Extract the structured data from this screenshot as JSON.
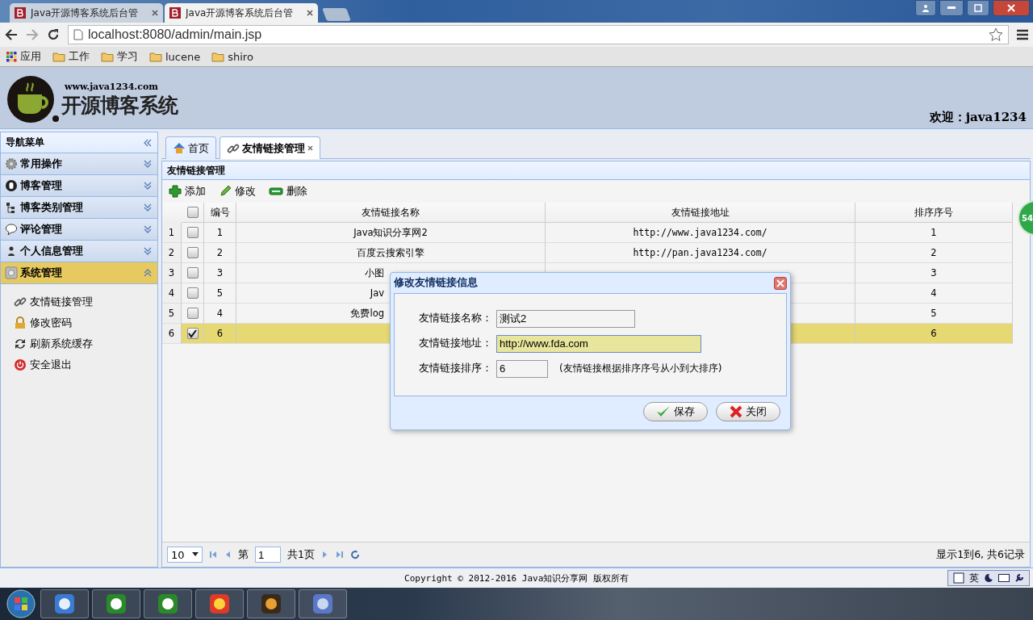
{
  "browser": {
    "tabs": [
      {
        "title": "Java开源博客系统后台管",
        "selected": false
      },
      {
        "title": "Java开源博客系统后台管",
        "selected": true
      }
    ],
    "address": "localhost:8080/admin/main.jsp",
    "bookmarks": [
      {
        "label": "应用",
        "kind": "apps"
      },
      {
        "label": "工作",
        "kind": "folder"
      },
      {
        "label": "学习",
        "kind": "folder"
      },
      {
        "label": "lucene",
        "kind": "folder"
      },
      {
        "label": "shiro",
        "kind": "folder"
      }
    ]
  },
  "header": {
    "site_url": "www.java1234.com",
    "logo_text": "开源博客系统",
    "welcome": "欢迎：java1234"
  },
  "sidebar": {
    "title": "导航菜单",
    "sections": [
      {
        "label": "常用操作",
        "expanded": false
      },
      {
        "label": "博客管理",
        "expanded": false
      },
      {
        "label": "博客类别管理",
        "expanded": false
      },
      {
        "label": "评论管理",
        "expanded": false
      },
      {
        "label": "个人信息管理",
        "expanded": false
      },
      {
        "label": "系统管理",
        "expanded": true,
        "children": [
          {
            "label": "友情链接管理"
          },
          {
            "label": "修改密码"
          },
          {
            "label": "刷新系统缓存"
          },
          {
            "label": "安全退出"
          }
        ]
      }
    ]
  },
  "content_tabs": [
    {
      "label": "首页",
      "selected": false,
      "closable": false
    },
    {
      "label": "友情链接管理",
      "selected": true,
      "closable": true
    }
  ],
  "panel": {
    "title": "友情链接管理",
    "toolbar": [
      {
        "label": "添加",
        "kind": "add"
      },
      {
        "label": "修改",
        "kind": "edit"
      },
      {
        "label": "删除",
        "kind": "delete"
      }
    ],
    "table": {
      "select_all_checked": false,
      "columns": [
        "编号",
        "友情链接名称",
        "友情链接地址",
        "排序序号"
      ],
      "rows": [
        {
          "num": "1",
          "checked": false,
          "selected": false,
          "id": "1",
          "name": "Java知识分享网2",
          "url": "http://www.java1234.com/",
          "order": "1"
        },
        {
          "num": "2",
          "checked": false,
          "selected": false,
          "id": "2",
          "name": "百度云搜索引擎",
          "url": "http://pan.java1234.com/",
          "order": "2"
        },
        {
          "num": "3",
          "checked": false,
          "selected": false,
          "id": "3",
          "name": "小图",
          "order": "3"
        },
        {
          "num": "4",
          "checked": false,
          "selected": false,
          "id": "5",
          "name": "Jav",
          "order": "4"
        },
        {
          "num": "5",
          "checked": false,
          "selected": false,
          "id": "4",
          "name": "免费log",
          "order": "5"
        },
        {
          "num": "6",
          "checked": true,
          "selected": true,
          "id": "6",
          "order": "6"
        }
      ]
    },
    "pager": {
      "page_size": "10",
      "before": "第",
      "page": "1",
      "after": "共1页",
      "summary": "显示1到6, 共6记录"
    }
  },
  "dialog": {
    "title": "修改友情链接信息",
    "fields": [
      {
        "label": "友情链接名称：",
        "value": "测试2",
        "focused": false,
        "kind": "medium"
      },
      {
        "label": "友情链接地址：",
        "value": "http://www.fda.com",
        "focused": true,
        "kind": "wide"
      },
      {
        "label": "友情链接排序：",
        "value": "6",
        "focused": false,
        "kind": "short",
        "hint": "(友情链接根据排序序号从小到大排序)"
      }
    ],
    "buttons": [
      {
        "label": "保存",
        "kind": "save"
      },
      {
        "label": "关闭",
        "kind": "close"
      }
    ]
  },
  "side_badge": "54",
  "footer": {
    "copyright": "Copyright © 2012-2016 Java知识分享网 版权所有",
    "ime": "英"
  }
}
